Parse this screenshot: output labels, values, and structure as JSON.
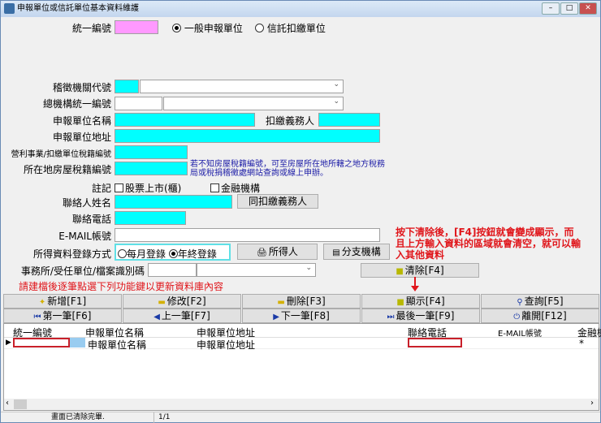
{
  "window": {
    "title": "申報單位或信託單位基本資料維護"
  },
  "form": {
    "ban_label": "統一編號",
    "radio_general": "一般申報單位",
    "radio_trust": "信託扣繳單位",
    "tax_office_label": "稽徵機關代號",
    "hq_ban_label": "總機構統一編號",
    "unit_name_label": "申報單位名稱",
    "withholder_label": "扣繳義務人",
    "unit_address_label": "申報單位地址",
    "business_tax_label": "營利事業/扣繳單位稅籍編號",
    "house_tax_label": "所在地房屋稅籍編號",
    "house_tax_note": "若不知房屋稅籍編號，可至房屋所在地所轄之地方稅務局或稅捐稽徵處網站查詢或線上申辦。",
    "note_label": "註記",
    "cb_listed": "股票上市(櫃)",
    "cb_financial": "金融機構",
    "contact_name_label": "聯絡人姓名",
    "same_withholder_btn": "同扣繳義務人",
    "phone_label": "聯絡電話",
    "email_label": "E-MAIL帳號",
    "income_mode_label": "所得資料登錄方式",
    "radio_monthly": "每月登錄",
    "radio_yearly": "年終登錄",
    "income_person_btn": "所得人",
    "branch_btn": "分支機構",
    "office_label": "事務所/受任單位/檔案識別碼",
    "clear_btn": "清除[F4]",
    "hint": "請建檔後逐筆點選下列功能鍵以更新資料庫內容",
    "annotation": "按下清除後，[F4]按鈕就會變成顯示，而且上方輸入資料的區域就會清空，就可以輸入其他資料"
  },
  "toolbar": {
    "row1": [
      "新增[F1]",
      "修改[F2]",
      "刪除[F3]",
      "顯示[F4]",
      "查詢[F5]"
    ],
    "row2": [
      "第一筆[F6]",
      "上一筆[F7]",
      "下一筆[F8]",
      "最後一筆[F9]",
      "離開[F12]"
    ]
  },
  "grid": {
    "headers": [
      "統一編號",
      "申報單位名稱",
      "申報單位地址",
      "聯絡電話",
      "E-MAIL帳號",
      "金融機"
    ],
    "row": {
      "name": "申報單位名稱",
      "address": "申報單位地址",
      "financial": "*"
    }
  },
  "status": {
    "message": "畫面已清除完畢.",
    "page": "1/1"
  }
}
